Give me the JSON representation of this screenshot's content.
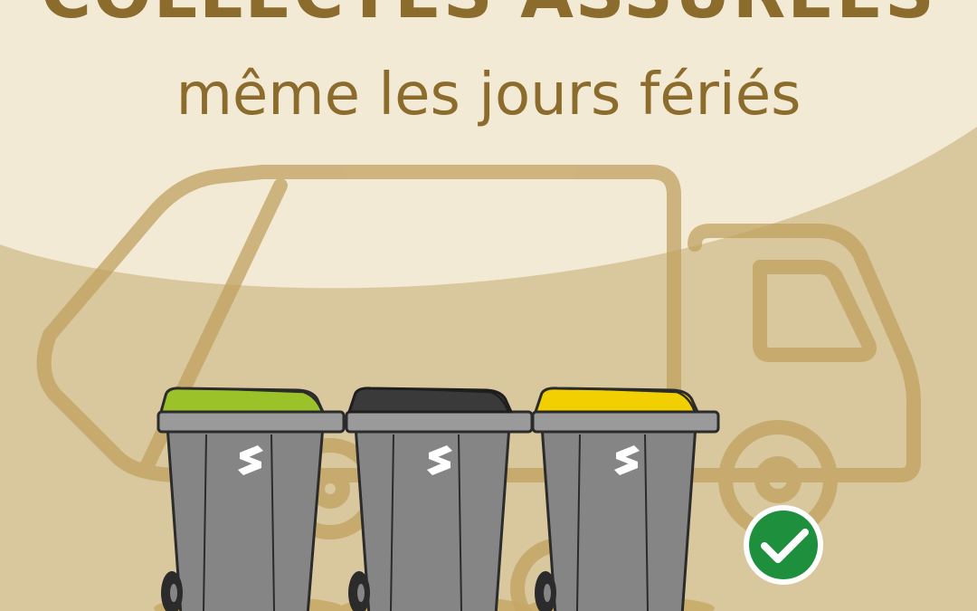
{
  "headline": {
    "line1": "COLLECTES ASSURÉES",
    "line2": "même les jours fériés"
  },
  "icons": {
    "truck": "garbage-truck-outline-icon",
    "check": "check-circle-icon",
    "bin_logo": "brand-s-logo-icon"
  },
  "bins": [
    {
      "lid": "green",
      "lid_color": "#9cc22a"
    },
    {
      "lid": "black",
      "lid_color": "#3a3a3a"
    },
    {
      "lid": "yellow",
      "lid_color": "#f1cf00"
    }
  ],
  "colors": {
    "background_tan": "#d9c79d",
    "background_cream": "#f3ead5",
    "truck_outline": "#bf9f5c",
    "headline": "#8c6c2c",
    "bin_body": "#858585",
    "check_green": "#1e8f3c"
  }
}
